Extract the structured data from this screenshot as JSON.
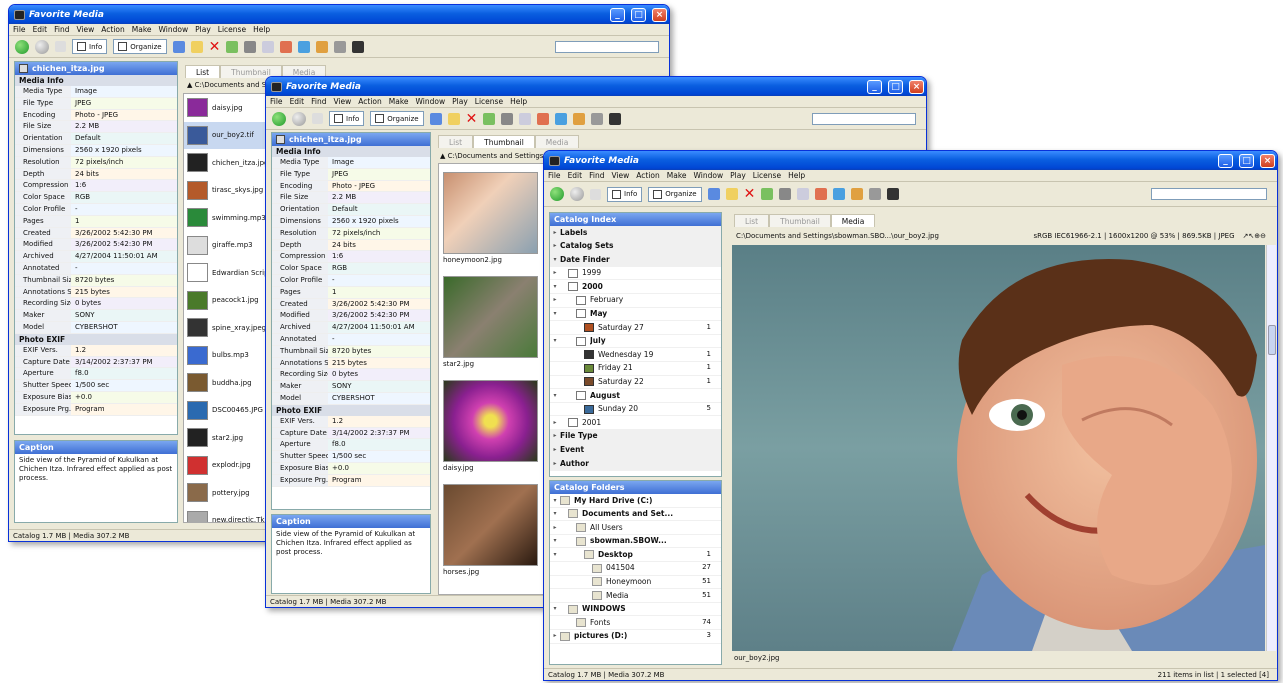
{
  "app": {
    "title": "Favorite Media",
    "menus": [
      "File",
      "Edit",
      "Find",
      "View",
      "Action",
      "Make",
      "Window",
      "Play",
      "License",
      "Help"
    ],
    "info_label": "Info",
    "organize_label": "Organize"
  },
  "info": {
    "filename": "chichen_itza.jpg",
    "section_media": "Media Info",
    "section_exif": "Photo EXIF",
    "rows": [
      [
        "Media Type",
        "Image"
      ],
      [
        "File Type",
        "JPEG"
      ],
      [
        "Encoding",
        "Photo - JPEG"
      ],
      [
        "File Size",
        "2.2 MB"
      ],
      [
        "Orientation",
        "Default"
      ],
      [
        "Dimensions",
        "2560 x 1920 pixels"
      ],
      [
        "Resolution",
        "72 pixels/inch"
      ],
      [
        "Depth",
        "24 bits"
      ],
      [
        "Compression",
        "1:6"
      ],
      [
        "Color Space",
        "RGB"
      ],
      [
        "Color Profile",
        "-"
      ],
      [
        "Pages",
        "1"
      ],
      [
        "Created",
        "3/26/2002 5:42:30 PM"
      ],
      [
        "Modified",
        "3/26/2002 5:42:30 PM"
      ],
      [
        "Archived",
        "4/27/2004 11:50:01 AM"
      ],
      [
        "Annotated",
        "-"
      ],
      [
        "Thumbnail Size",
        "8720 bytes"
      ],
      [
        "Annotations Size",
        "215 bytes"
      ],
      [
        "Recording Size",
        "0 bytes"
      ],
      [
        "Maker",
        "SONY"
      ],
      [
        "Model",
        "CYBERSHOT"
      ]
    ],
    "exif_rows": [
      [
        "EXIF Vers.",
        "1.2"
      ],
      [
        "Capture Date",
        "3/14/2002 2:37:37 PM"
      ],
      [
        "Aperture",
        "f8.0"
      ],
      [
        "Shutter Speed",
        "1/500 sec"
      ],
      [
        "Exposure Bias",
        "+0.0"
      ],
      [
        "Exposure Prg.",
        "Program"
      ]
    ],
    "caption_title": "Caption",
    "caption": "Side view of the Pyramid of Kukulkan at Chichen Itza. Infrared effect applied as post process."
  },
  "status_left": "Catalog 1.7 MB | Media 307.2 MB",
  "tabs": [
    "List",
    "Thumbnail",
    "Media"
  ],
  "w1": {
    "path": "C:\\Documents and Set",
    "files": [
      "daisy.jpg",
      "our_boy2.tif",
      "chichen_itza.jpg",
      "tirasc_skys.jpg",
      "swimming.mp3",
      "giraffe.mp3",
      "Edwardian Script",
      "peacock1.jpg",
      "spine_xray.jpeg",
      "bulbs.mp3",
      "buddha.jpg",
      "DSC00465.JPG",
      "star2.jpg",
      "explodr.jpg",
      "pottery.jpg",
      "new.directic.Tkn"
    ]
  },
  "w2": {
    "path": "C:\\Documents and Settings",
    "thumbs": [
      "honeymoon2.jpg",
      "star2.jpg",
      "daisy.jpg",
      "horses.jpg"
    ]
  },
  "w3": {
    "index_title": "Catalog Index",
    "path": "C:\\Documents and Settings\\sbowman.SBO...\\our_boy2.jpg",
    "media_info": "sRGB IEC61966-2.1 | 1600x1200 @ 53% | 869.5KB | JPEG",
    "index": [
      {
        "a": "▸",
        "n": "Labels",
        "b": true,
        "c": ""
      },
      {
        "a": "▸",
        "n": "Catalog Sets",
        "b": true,
        "c": ""
      },
      {
        "a": "▾",
        "n": "Date Finder",
        "b": true,
        "c": ""
      },
      {
        "a": "▸",
        "n": "1999",
        "b": false,
        "c": "",
        "box": true,
        "ind": 1
      },
      {
        "a": "▾",
        "n": "2000",
        "b": true,
        "c": "",
        "box": true,
        "ind": 1
      },
      {
        "a": "▸",
        "n": "February",
        "b": false,
        "c": "",
        "box": true,
        "ind": 2
      },
      {
        "a": "▾",
        "n": "May",
        "b": true,
        "c": "",
        "box": true,
        "ind": 2
      },
      {
        "a": "",
        "n": "Saturday 27",
        "b": false,
        "c": "1",
        "ph": "#b05020",
        "ind": 3
      },
      {
        "a": "▾",
        "n": "July",
        "b": true,
        "c": "",
        "box": true,
        "ind": 2
      },
      {
        "a": "",
        "n": "Wednesday 19",
        "b": false,
        "c": "1",
        "ph": "#333",
        "ind": 3
      },
      {
        "a": "",
        "n": "Friday 21",
        "b": false,
        "c": "1",
        "ph": "#6a8a3a",
        "ind": 3
      },
      {
        "a": "",
        "n": "Saturday 22",
        "b": false,
        "c": "1",
        "ph": "#7a4a2a",
        "ind": 3
      },
      {
        "a": "▾",
        "n": "August",
        "b": true,
        "c": "",
        "box": true,
        "ind": 2
      },
      {
        "a": "",
        "n": "Sunday 20",
        "b": false,
        "c": "5",
        "ph": "#3a6a9a",
        "ind": 3
      },
      {
        "a": "▸",
        "n": "2001",
        "b": false,
        "c": "",
        "box": true,
        "ind": 1
      },
      {
        "a": "▸",
        "n": "File Type",
        "b": true,
        "c": ""
      },
      {
        "a": "▸",
        "n": "Event",
        "b": true,
        "c": ""
      },
      {
        "a": "▸",
        "n": "Author",
        "b": true,
        "c": ""
      }
    ],
    "folders_title": "Catalog Folders",
    "folders": [
      {
        "a": "▾",
        "n": "My Hard Drive (C:)",
        "b": true,
        "c": "",
        "ind": 0
      },
      {
        "a": "▾",
        "n": "Documents and Set...",
        "b": true,
        "c": "",
        "ind": 1
      },
      {
        "a": "▸",
        "n": "All Users",
        "b": false,
        "c": "",
        "ind": 2
      },
      {
        "a": "▾",
        "n": "sbowman.SBOW...",
        "b": true,
        "c": "",
        "ind": 2
      },
      {
        "a": "▾",
        "n": "Desktop",
        "b": true,
        "c": "1",
        "ind": 3
      },
      {
        "a": "",
        "n": "041504",
        "b": false,
        "c": "27",
        "ind": 4
      },
      {
        "a": "",
        "n": "Honeymoon",
        "b": false,
        "c": "51",
        "ind": 4
      },
      {
        "a": "",
        "n": "Media",
        "b": false,
        "c": "51",
        "ind": 4
      },
      {
        "a": "▾",
        "n": "WINDOWS",
        "b": true,
        "c": "",
        "ind": 1
      },
      {
        "a": "",
        "n": "Fonts",
        "b": false,
        "c": "74",
        "ind": 2
      },
      {
        "a": "▸",
        "n": "pictures (D:)",
        "b": true,
        "c": "3",
        "ind": 0
      }
    ],
    "caption": "our_boy2.jpg",
    "status_right": "211 items in list | 1 selected [4]"
  }
}
